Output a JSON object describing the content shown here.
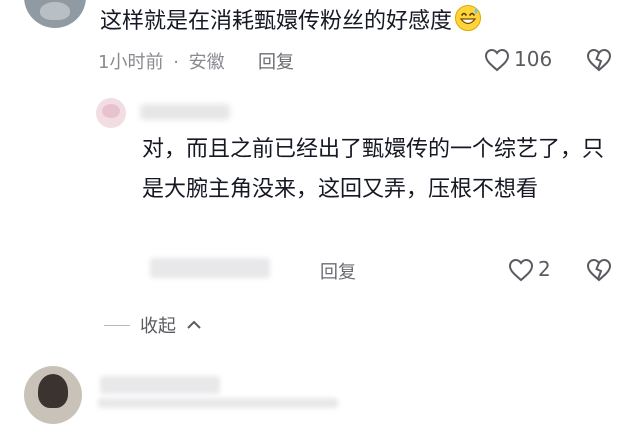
{
  "comment": {
    "text": "这样就是在消耗甄嬛传粉丝的好感度",
    "emoji_icon": "grinning-sweat-emoji",
    "time": "1小时前",
    "separator": "·",
    "location": "安徽",
    "reply_label": "回复",
    "like_count": "106"
  },
  "reply": {
    "text": "对，而且之前已经出了甄嬛传的一个综艺了，只是大腕主角没来，这回又弄，压根不想看",
    "reply_label": "回复",
    "like_count": "2"
  },
  "thread": {
    "collapse_label": "收起"
  },
  "colors": {
    "primary_text": "#161823",
    "secondary_text": "#8a8b91"
  }
}
